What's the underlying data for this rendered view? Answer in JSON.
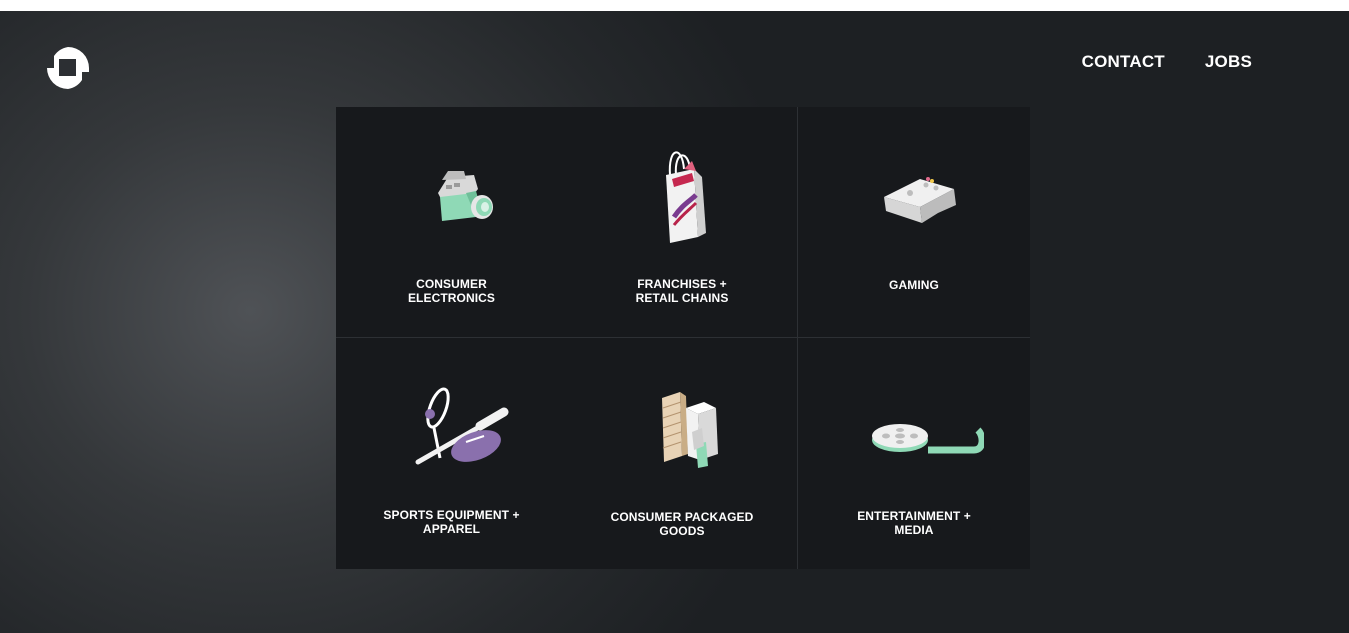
{
  "nav": {
    "contact": "CONTACT",
    "jobs": "JOBS"
  },
  "tiles": [
    {
      "label": "CONSUMER\nELECTRONICS",
      "icon": "camera-icon"
    },
    {
      "label": "FRANCHISES +\nRETAIL CHAINS",
      "icon": "shopping-bag-icon"
    },
    {
      "label": "GAMING",
      "icon": "game-controller-icon"
    },
    {
      "label": "SPORTS EQUIPMENT +\nAPPAREL",
      "icon": "sports-equipment-icon"
    },
    {
      "label": "CONSUMER PACKAGED\nGOODS",
      "icon": "packaged-goods-icon"
    },
    {
      "label": "ENTERTAINMENT +\nMEDIA",
      "icon": "film-reel-icon"
    }
  ],
  "colors": {
    "tile_bg": "#17191c",
    "mint": "#8fd9b6",
    "purple": "#8a70ad",
    "crimson": "#b8234a"
  }
}
